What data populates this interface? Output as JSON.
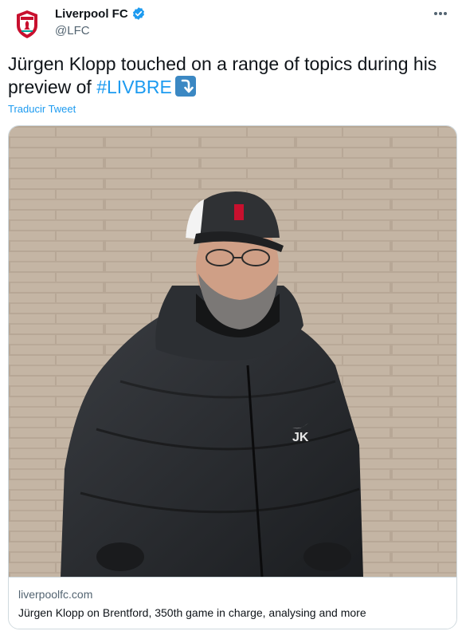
{
  "account": {
    "name": "Liverpool FC",
    "handle": "@LFC",
    "avatar_icon": "liverpool-crest-icon",
    "verified_icon": "verified-badge-icon",
    "verified_color": "#1d9bf0"
  },
  "menu": {
    "icon": "more-options-icon"
  },
  "tweet": {
    "text_before": "Jürgen Klopp touched on a range of topics during his preview of ",
    "hashtag": "#LIVBRE",
    "emoji_icon": "right-arrow-curving-down-icon"
  },
  "translate_label": "Traducir Tweet",
  "card": {
    "image_icon": "klopp-photo",
    "domain": "liverpoolfc.com",
    "title": "Jürgen Klopp on Brentford, 350th game in charge, analysing and more"
  },
  "colors": {
    "accent": "#1d9bf0",
    "text": "#0f1419",
    "muted": "#536471",
    "border": "#cfd9de"
  }
}
